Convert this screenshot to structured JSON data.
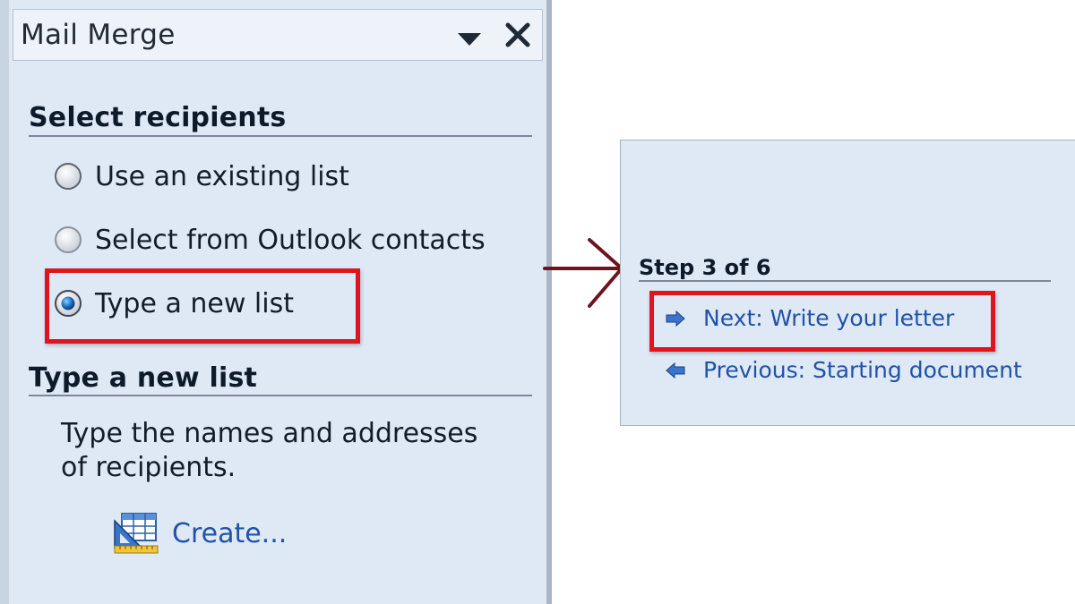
{
  "task_pane": {
    "title": "Mail Merge",
    "dropdown_icon": "chevron-down-icon",
    "close_icon": "close-icon",
    "select_recipients": {
      "heading": "Select recipients",
      "options": [
        {
          "label": "Use an existing list",
          "selected": false
        },
        {
          "label": "Select from Outlook contacts",
          "selected": false
        },
        {
          "label": "Type a new list",
          "selected": true
        }
      ]
    },
    "type_new_list": {
      "heading": "Type a new list",
      "description": "Type the names and addresses of recipients.",
      "create_label": "Create...",
      "create_icon": "table-ruler-icon"
    }
  },
  "step_panel": {
    "heading": "Step 3 of 6",
    "next_label": "Next: Write your letter",
    "next_icon": "arrow-right-icon",
    "previous_label": "Previous: Starting document",
    "previous_icon": "arrow-left-icon"
  },
  "colors": {
    "pane_background": "#dfe9f6",
    "highlight": "#e0141c",
    "link": "#1f52a8",
    "connector_arrow": "#6e1420"
  }
}
